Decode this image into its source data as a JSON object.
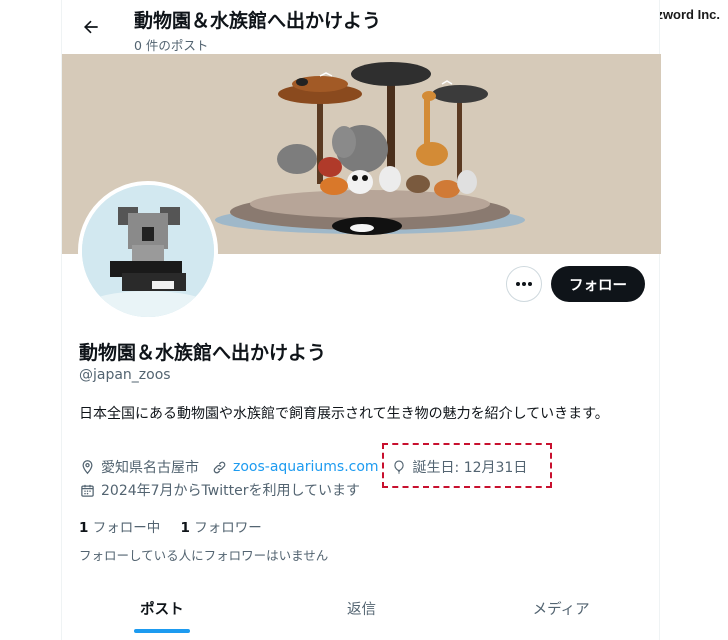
{
  "brand": "Buzzword Inc.",
  "header": {
    "title": "動物園＆水族館へ出かけよう",
    "subtitle": "0 件のポスト"
  },
  "profile": {
    "name": "動物園＆水族館へ出かけよう",
    "handle": "@japan_zoos",
    "bio": "日本全国にある動物園や水族館で飼育展示されて生き物の魅力を紹介していきます。",
    "location": "愛知県名古屋市",
    "website": "zoos-aquariums.com",
    "birthday": "誕生日: 12月31日",
    "joined": "2024年7月からTwitterを利用しています",
    "following_count": "1",
    "following_label": "フォロー中",
    "followers_count": "1",
    "followers_label": "フォロワー",
    "no_followers_note": "フォローしている人にフォロワーはいません"
  },
  "actions": {
    "more": "•••",
    "follow": "フォロー"
  },
  "tabs": [
    {
      "label": "ポスト",
      "active": true
    },
    {
      "label": "返信",
      "active": false
    },
    {
      "label": "メディア",
      "active": false
    }
  ],
  "colors": {
    "accent": "#1d9bf0",
    "text": "#0f1419",
    "secondary": "#536471",
    "highlight_box": "#c8102e"
  },
  "icons": {
    "back": "arrow-left-icon",
    "location": "location-pin-icon",
    "link": "link-icon",
    "birthday": "balloon-icon",
    "calendar": "calendar-icon"
  }
}
